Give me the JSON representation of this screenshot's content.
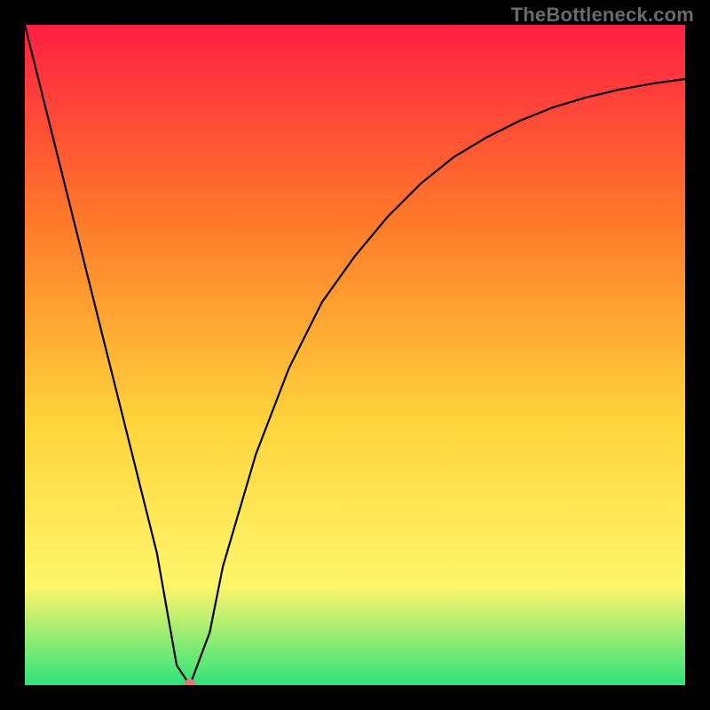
{
  "watermark": "TheBottleneck.com",
  "chart_data": {
    "type": "line",
    "title": "",
    "xlabel": "",
    "ylabel": "",
    "xlim": [
      0,
      100
    ],
    "ylim": [
      0,
      100
    ],
    "grid": false,
    "legend": false,
    "annotations": [],
    "gradient_colors": {
      "top": "#ff1f43",
      "mid_upper": "#ff7a2a",
      "mid": "#ffd43b",
      "mid_lower": "#fff66b",
      "bottom": "#2fe37a"
    },
    "series": [
      {
        "name": "bottleneck-curve",
        "x": [
          0,
          5,
          10,
          15,
          20,
          23,
          25,
          28,
          30,
          35,
          40,
          45,
          50,
          55,
          60,
          65,
          70,
          75,
          80,
          85,
          90,
          95,
          100
        ],
        "y": [
          100,
          80,
          60,
          40,
          20,
          3,
          0,
          8,
          18,
          35,
          48,
          58,
          65,
          71,
          76,
          80,
          83,
          85.5,
          87.5,
          89,
          90.2,
          91.1,
          91.8
        ]
      }
    ],
    "marker": {
      "x": 25,
      "y": 0,
      "color": "#e07a7a",
      "radius_px": 7
    }
  }
}
